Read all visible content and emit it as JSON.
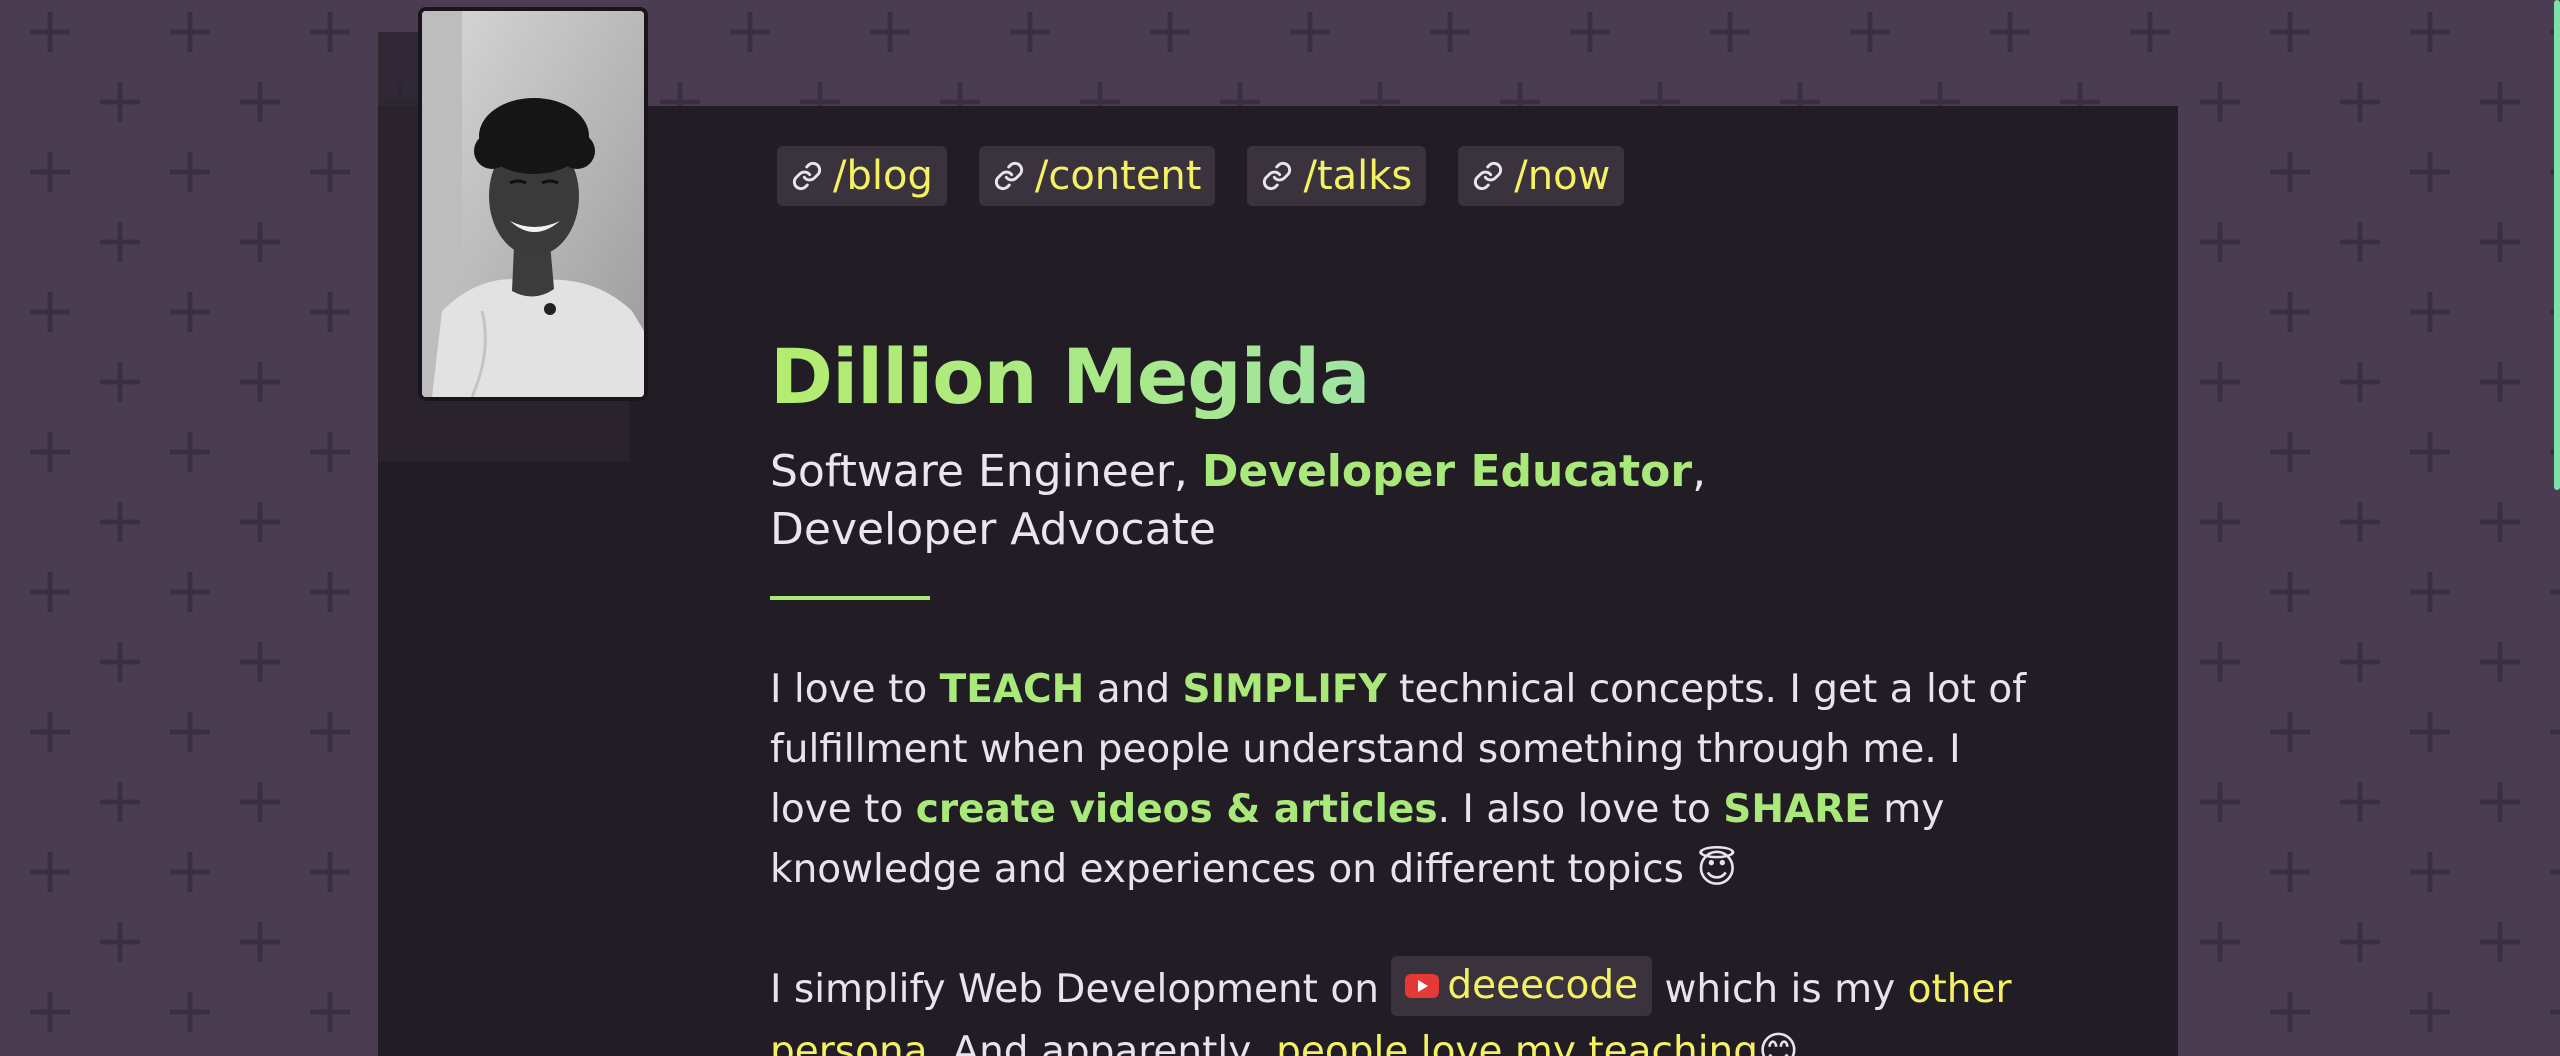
{
  "nav": {
    "links": [
      {
        "label": "/blog",
        "icon": "link-icon"
      },
      {
        "label": "/content",
        "icon": "link-icon"
      },
      {
        "label": "/talks",
        "icon": "link-icon"
      },
      {
        "label": "/now",
        "icon": "link-icon"
      }
    ]
  },
  "profile": {
    "name": "Dillion Megida",
    "roles": {
      "role1": "Software Engineer, ",
      "role2": "Developer Educator",
      "role2_suffix": ",",
      "role3": "Developer Advocate"
    }
  },
  "bio": {
    "p1_a": "I love to ",
    "p1_teach": "TEACH",
    "p1_b": " and ",
    "p1_simplify": "SIMPLIFY",
    "p1_c": " technical concepts. I get a lot of fulfillment when people understand something through me. I love to ",
    "p1_create": "create videos & articles",
    "p1_d": ". I also love to ",
    "p1_share": "SHARE",
    "p1_e": " my knowledge and experiences on different topics ",
    "p1_emoji": "😇",
    "p2_a": "I simplify Web Development on ",
    "p2_channel": "deeecode",
    "p2_b": " which is my ",
    "p2_other": "other persona",
    "p2_c": ". And apparently, ",
    "p2_love": "people love my teaching",
    "p2_emoji": "😊"
  },
  "colors": {
    "background": "#4a3d51",
    "card": "#221c25",
    "accent_green": "#a9e97a",
    "link_yellow": "#f4f162",
    "chip_bg": "#3a333d"
  }
}
